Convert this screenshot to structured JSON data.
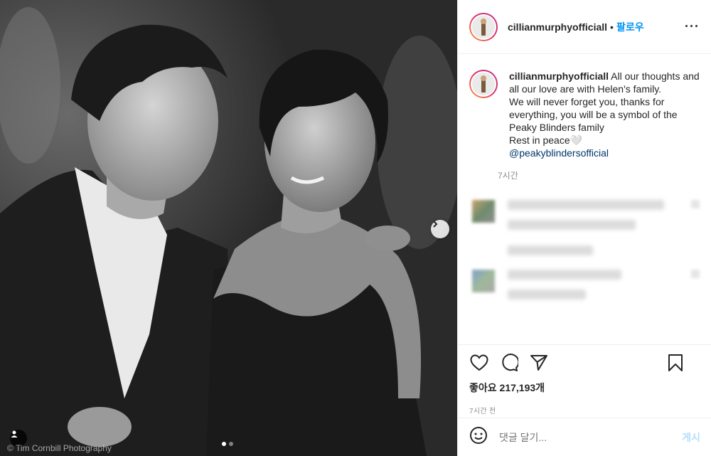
{
  "photo": {
    "credit": "© Tim Cornbill Photography",
    "carousel_count": 2,
    "carousel_active": 1
  },
  "header": {
    "username": "cillianmurphyofficiall",
    "separator": "•",
    "follow_label": "팔로우",
    "more_label": "···"
  },
  "caption": {
    "username": "cillianmurphyofficiall",
    "lines": [
      "All our thoughts and all our love are with Helen's family.",
      "We will never forget you, thanks for everything, you will be a symbol of the Peaky Blinders family",
      "Rest in peace🤍"
    ],
    "mention": "@peakyblindersofficial",
    "time": "7시간"
  },
  "stats": {
    "likes": "좋아요 217,193개",
    "ago": "7시간 전"
  },
  "comment_box": {
    "placeholder": "댓글 달기...",
    "post_label": "게시"
  },
  "icons": {
    "like": "heart-icon",
    "comment": "comment-icon",
    "share": "share-icon",
    "save": "bookmark-icon",
    "emoji": "emoji-icon",
    "next": "chevron-right-icon",
    "tag": "user-tag-icon"
  },
  "colors": {
    "accent": "#0095f6",
    "mention": "#00376b",
    "muted": "#8e8e8e"
  }
}
